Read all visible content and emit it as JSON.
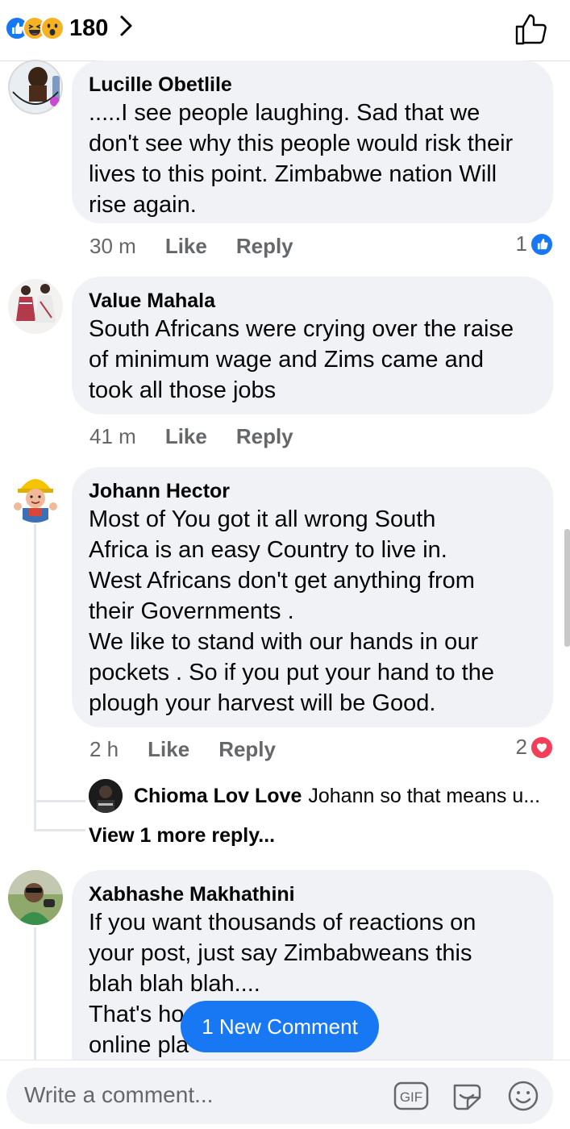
{
  "header": {
    "reactions": [
      "like-icon",
      "haha-icon",
      "wow-icon"
    ],
    "reaction_count": "180",
    "chevron": "›"
  },
  "comments": [
    {
      "author": "Lucille Obetlile",
      "text": ".....I see people laughing. Sad that we\ndon't see why this people would risk their\nlives to this point. Zimbabwe nation  Will\nrise again.",
      "time": "30 m",
      "like": "Like",
      "reply": "Reply",
      "reaction_count": "1",
      "reaction": "like-icon"
    },
    {
      "author": "Value Mahala",
      "text": "South Africans were crying over the raise\nof minimum wage and Zims came and\ntook all those jobs",
      "time": "41 m",
      "like": "Like",
      "reply": "Reply"
    },
    {
      "author": "Johann Hector",
      "text": "Most of You got it all wrong   South\nAfrica is an easy Country to live in.\nWest Africans don't get anything from\ntheir Governments .\nWe like to stand with our hands in our\npockets . So if you put your hand to the\nplough your harvest will be Good.",
      "time": "2 h",
      "like": "Like",
      "reply": "Reply",
      "reaction_count": "2",
      "reaction": "love-icon"
    },
    {
      "author": "Xabhashe Makhathini",
      "text": "If you want thousands of reactions on\nyour post, just say Zimbabweans this\nblah blah blah....\nThat's ho                                    on any news\nonline pla"
    }
  ],
  "reply_preview": {
    "author": "Chioma Lov Love",
    "text": "Johann  so that means u..."
  },
  "view_more": "View 1 more reply...",
  "new_comment_button": "1 New Comment",
  "composer": {
    "placeholder": "Write a comment...",
    "icons": [
      "gif-icon",
      "sticker-icon",
      "emoji-icon"
    ],
    "gif_label": "GIF"
  },
  "colors": {
    "accent": "#1877f2",
    "love": "#f33e58",
    "bubble": "#f0f2f5",
    "secondary_text": "#65676b"
  }
}
